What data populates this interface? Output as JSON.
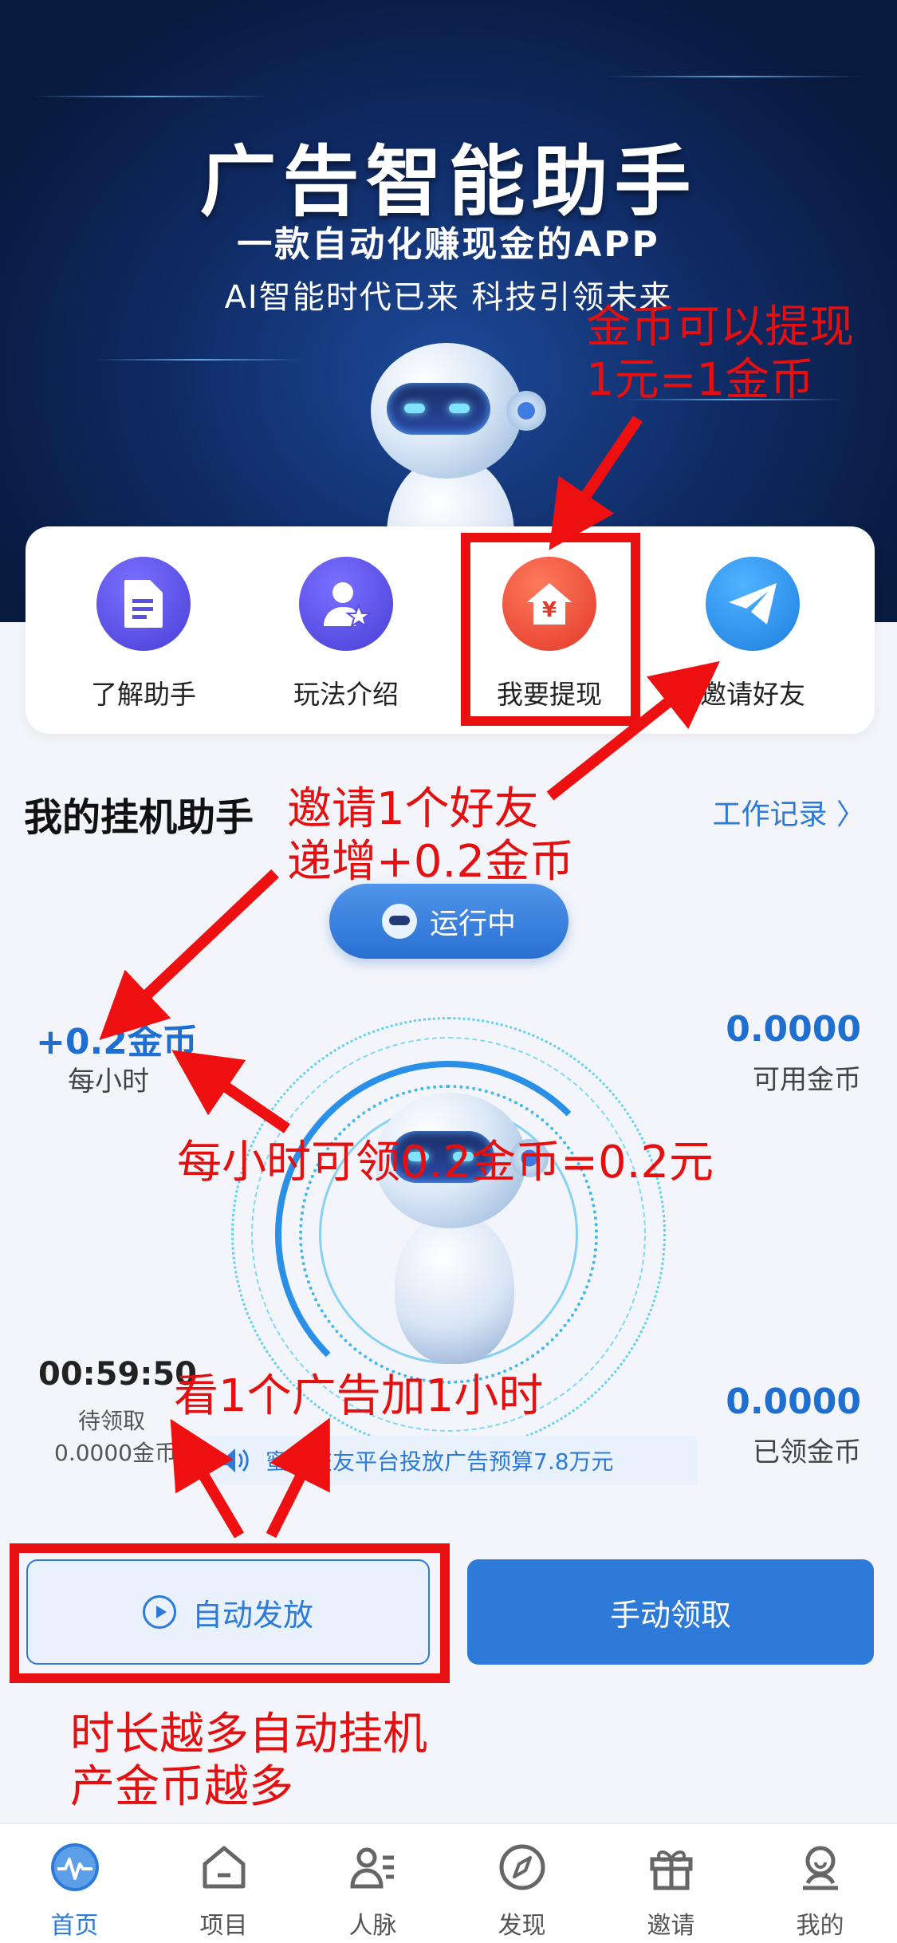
{
  "banner": {
    "title": "广告智能助手",
    "subtitle": "一款自动化赚现金的APP",
    "slogan": "AI智能时代已来 科技引领未来"
  },
  "menu": [
    {
      "label": "了解助手",
      "icon": "document-icon",
      "color": "#5a4fe0"
    },
    {
      "label": "玩法介绍",
      "icon": "user-star-icon",
      "color": "#5a4fe0"
    },
    {
      "label": "我要提现",
      "icon": "withdraw-house-icon",
      "color": "#e84a3a"
    },
    {
      "label": "邀请好友",
      "icon": "paper-plane-icon",
      "color": "#2b8de6"
    }
  ],
  "section": {
    "title": "我的挂机助手",
    "work_log": "工作记录 〉",
    "status": "运行中"
  },
  "stats": {
    "rate_value": "+0.2金币",
    "rate_label": "每小时",
    "available_value": "0.0000",
    "available_label": "可用金币",
    "timer_value": "00:59:50",
    "pending_label": "待领取",
    "pending_amount": "0.0000金币",
    "claimed_value": "0.0000",
    "claimed_label": "已领金币"
  },
  "notice": {
    "text": "蜜志交友平台投放广告预算7.8万元"
  },
  "buttons": {
    "auto": "自动发放",
    "manual": "手动领取"
  },
  "annotations": {
    "withdraw": "金币可以提现\n1元=1金币",
    "invite": "邀请1个好友\n递增+0.2金币",
    "hourly": "每小时可领0.2金币=0.2元",
    "ad": "看1个广告加1小时",
    "duration": "时长越多自动挂机\n产金币越多"
  },
  "tabs": [
    {
      "label": "首页",
      "icon": "pulse-icon",
      "active": true
    },
    {
      "label": "项目",
      "icon": "home-icon",
      "active": false
    },
    {
      "label": "人脉",
      "icon": "contacts-icon",
      "active": false
    },
    {
      "label": "发现",
      "icon": "compass-icon",
      "active": false
    },
    {
      "label": "邀请",
      "icon": "gift-icon",
      "active": false
    },
    {
      "label": "我的",
      "icon": "profile-icon",
      "active": false
    }
  ],
  "colors": {
    "primary": "#2d7ad8",
    "annotation": "#e41010",
    "banner_dark": "#0f2a63"
  }
}
